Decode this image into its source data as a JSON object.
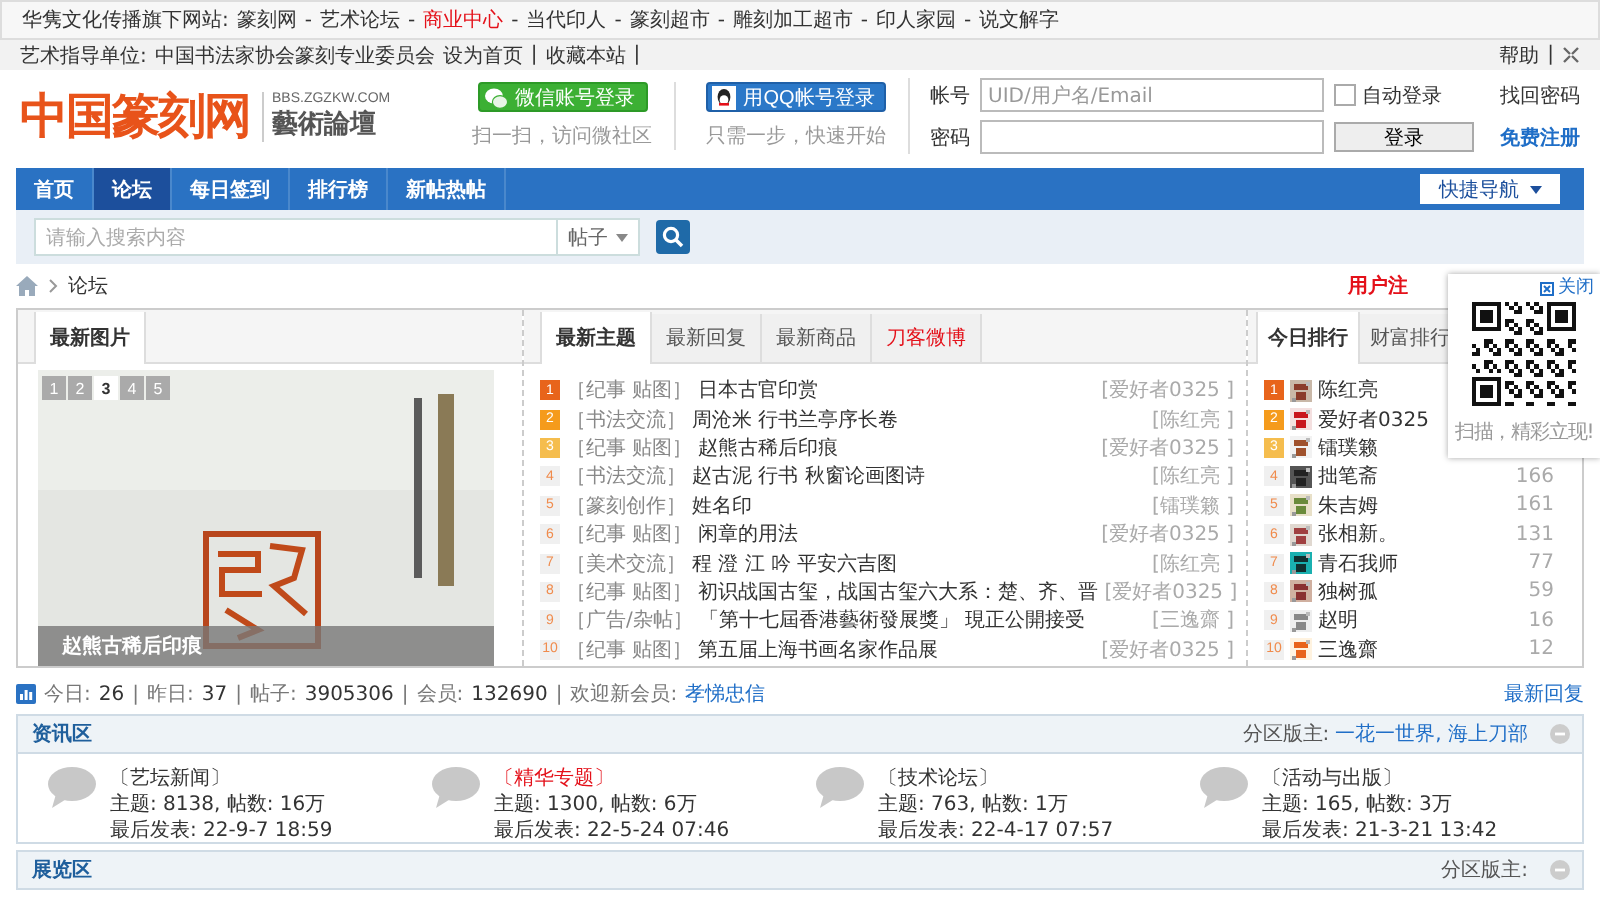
{
  "top_bar": {
    "label": "华隽文化传播旗下网站:",
    "separator": "-",
    "links": [
      {
        "label": "篆刻网",
        "highlight": false
      },
      {
        "label": "艺术论坛",
        "highlight": false
      },
      {
        "label": "商业中心",
        "highlight": true
      },
      {
        "label": "当代印人",
        "highlight": false
      },
      {
        "label": "篆刻超市",
        "highlight": false
      },
      {
        "label": "雕刻加工超市",
        "highlight": false
      },
      {
        "label": "印人家园",
        "highlight": false
      },
      {
        "label": "说文解字",
        "highlight": false
      }
    ]
  },
  "sub_bar": {
    "label": "艺术指导单位:",
    "org": "中国书法家协会篆刻专业委员会",
    "separator": "|",
    "links": [
      "设为首页",
      "收藏本站"
    ],
    "right_links": [
      "帮助"
    ]
  },
  "header": {
    "logo": "中国篆刻网",
    "domain": "BBS.ZGZKW.COM",
    "subtitle": "藝術論壇",
    "social": [
      {
        "kind": "wechat",
        "label": "微信账号登录",
        "caption": "扫一扫，访问微社区"
      },
      {
        "kind": "qq",
        "label": "用QQ帐号登录",
        "caption": "只需一步，快速开始"
      }
    ],
    "login": {
      "account_label": "帐号",
      "account_placeholder": "UID/用户名/Email",
      "password_label": "密码",
      "remember": {
        "label": "自动登录",
        "checked": false
      },
      "submit": "登录",
      "links": [
        {
          "label": "找回密码",
          "kind": "plain"
        },
        {
          "label": "免费注册",
          "kind": "strong"
        }
      ]
    }
  },
  "nav": {
    "items": [
      {
        "label": "首页",
        "selected": false
      },
      {
        "label": "论坛",
        "selected": true
      },
      {
        "label": "每日签到",
        "selected": false
      },
      {
        "label": "排行榜",
        "selected": false
      },
      {
        "label": "新帖热帖",
        "selected": false
      }
    ],
    "quick_nav": "快捷导航"
  },
  "search": {
    "placeholder": "请输入搜索内容",
    "scope": "帖子"
  },
  "breadcrumb": {
    "items": [
      "论坛"
    ],
    "register": "用户注"
  },
  "pictures": {
    "tab": "最新图片",
    "pages": [
      {
        "label": "1",
        "selected": false
      },
      {
        "label": "2",
        "selected": false
      },
      {
        "label": "3",
        "selected": true
      },
      {
        "label": "4",
        "selected": false
      },
      {
        "label": "5",
        "selected": false
      }
    ],
    "caption": "赵熊古稀后印痕"
  },
  "threads": {
    "tabs": [
      {
        "label": "最新主题",
        "selected": true,
        "kind": "normal"
      },
      {
        "label": "最新回复",
        "selected": false,
        "kind": "normal"
      },
      {
        "label": "最新商品",
        "selected": false,
        "kind": "normal"
      },
      {
        "label": "刀客微博",
        "selected": false,
        "kind": "highlight"
      }
    ],
    "items": [
      {
        "rank": "1",
        "category": "［纪事 贴图］",
        "title": "日本古官印赏",
        "author": "[爱好者0325 ]"
      },
      {
        "rank": "2",
        "category": "［书法交流］",
        "title": "周沧米 行书兰亭序长卷",
        "author": "[陈红亮 ]"
      },
      {
        "rank": "3",
        "category": "［纪事 贴图］",
        "title": "赵熊古稀后印痕",
        "author": "[爱好者0325 ]"
      },
      {
        "rank": "4",
        "category": "［书法交流］",
        "title": "赵古泥 行书 秋窗论画图诗",
        "author": "[陈红亮 ]"
      },
      {
        "rank": "5",
        "category": "［篆刻创作］",
        "title": "姓名印",
        "author": "[镭璞籁 ]"
      },
      {
        "rank": "6",
        "category": "［纪事 贴图］",
        "title": "闲章的用法",
        "author": "[爱好者0325 ]"
      },
      {
        "rank": "7",
        "category": "［美术交流］",
        "title": "程 澄 江 吟 平安六吉图",
        "author": "[陈红亮 ]"
      },
      {
        "rank": "8",
        "category": "［纪事 贴图］",
        "title": "初识战国古玺，战国古玺六大系：楚、齐、晋",
        "author": "[爱好者0325 ]"
      },
      {
        "rank": "9",
        "category": "［广告/杂帖］",
        "title": "「第十七屆香港藝術發展獎」 現正公開接受",
        "author": "[三逸齋 ]"
      },
      {
        "rank": "10",
        "category": "［纪事 贴图］",
        "title": "第五届上海书画名家作品展",
        "author": "[爱好者0325 ]"
      }
    ]
  },
  "rankings": {
    "tabs": [
      {
        "label": "今日排行",
        "selected": true
      },
      {
        "label": "财富排行",
        "selected": false
      }
    ],
    "items": [
      {
        "rank": "1",
        "name": "陈红亮"
      },
      {
        "rank": "2",
        "name": "爱好者0325"
      },
      {
        "rank": "3",
        "name": "镭璞籁"
      },
      {
        "rank": "4",
        "name": "拙笔斋",
        "count": "166"
      },
      {
        "rank": "5",
        "name": "朱吉姆",
        "count": "161"
      },
      {
        "rank": "6",
        "name": "张相新。",
        "count": "131"
      },
      {
        "rank": "7",
        "name": "青石我师",
        "count": "77"
      },
      {
        "rank": "8",
        "name": "独树孤",
        "count": "59"
      },
      {
        "rank": "9",
        "name": "赵明",
        "count": "16"
      },
      {
        "rank": "10",
        "name": "三逸齋",
        "count": "12"
      }
    ]
  },
  "popup": {
    "close": "关闭",
    "caption": "扫描，精彩立现!"
  },
  "stats": {
    "separator": "|",
    "items": [
      {
        "label": "今日:",
        "value": "26",
        "kind": "plain"
      },
      {
        "label": "昨日:",
        "value": "37",
        "kind": "plain"
      },
      {
        "label": "帖子:",
        "value": "3905306",
        "kind": "plain"
      },
      {
        "label": "会员:",
        "value": "132690",
        "kind": "plain"
      },
      {
        "label": "欢迎新会员:",
        "value": "孝悌忠信",
        "kind": "link"
      }
    ],
    "latest": "最新回复"
  },
  "sections": [
    {
      "title": "资讯区",
      "moderator_label": "分区版主:",
      "moderators": "一花一世界, 海上刀部",
      "forums": [
        {
          "name": "〔艺坛新闻〕",
          "highlight": false,
          "counts": "主题: 8138, 帖数: 16万",
          "last_post": "最后发表: 22-9-7 18:59"
        },
        {
          "name": "〔精华专题〕",
          "highlight": true,
          "counts": "主题: 1300, 帖数: 6万",
          "last_post": "最后发表: 22-5-24 07:46"
        },
        {
          "name": "〔技术论坛〕",
          "highlight": false,
          "counts": "主题: 763, 帖数: 1万",
          "last_post": "最后发表: 22-4-17 07:57"
        },
        {
          "name": "〔活动与出版〕",
          "highlight": false,
          "counts": "主题: 165, 帖数: 3万",
          "last_post": "最后发表: 21-3-21 13:42"
        }
      ]
    },
    {
      "title": "展览区",
      "moderator_label": "分区版主:"
    }
  ]
}
